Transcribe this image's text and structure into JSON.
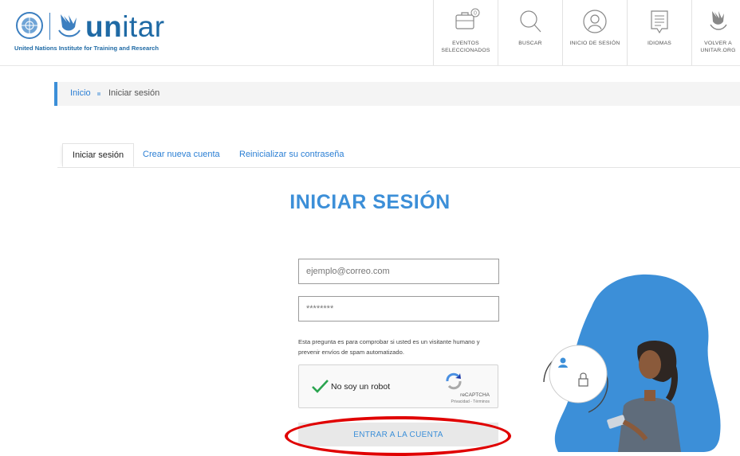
{
  "header": {
    "logo": {
      "wordmark": "unitar",
      "tagline": "United Nations Institute for Training and Research"
    },
    "nav": [
      {
        "label_line1": "EVENTOS",
        "label_line2": "SELECCIONADOS",
        "icon": "briefcase-icon",
        "badge": "0"
      },
      {
        "label_line1": "BUSCAR",
        "label_line2": "",
        "icon": "search-icon"
      },
      {
        "label_line1": "INICIO DE SESIÓN",
        "label_line2": "",
        "icon": "user-circle-icon"
      },
      {
        "label_line1": "IDIOMAS",
        "label_line2": "",
        "icon": "speech-doc-icon"
      },
      {
        "label_line1": "VOLVER A",
        "label_line2": "UNITAR.ORG",
        "icon": "unitar-bird-icon"
      }
    ]
  },
  "breadcrumb": {
    "home": "Inicio",
    "current": "Iniciar sesión"
  },
  "tabs": [
    {
      "label": "Iniciar sesión",
      "active": true
    },
    {
      "label": "Crear nueva cuenta",
      "active": false
    },
    {
      "label": "Reinicializar su contraseña",
      "active": false
    }
  ],
  "page_title": "INICIAR SESIÓN",
  "form": {
    "email_placeholder": "ejemplo@correo.com",
    "email_value": "",
    "password_placeholder": "********",
    "password_value": "",
    "help_text": "Esta pregunta es para comprobar si usted es un visitante humano y prevenir envíos de spam automatizado.",
    "captcha": {
      "label": "No soy un robot",
      "checked": true,
      "brand": "reCAPTCHA",
      "links": "Privacidad - Términos"
    },
    "submit_label": "ENTRAR A LA CUENTA"
  },
  "colors": {
    "accent": "#3c8fd8",
    "brand_blue": "#1f6aa5",
    "highlight": "#e00000",
    "check_green": "#2aa44f"
  }
}
